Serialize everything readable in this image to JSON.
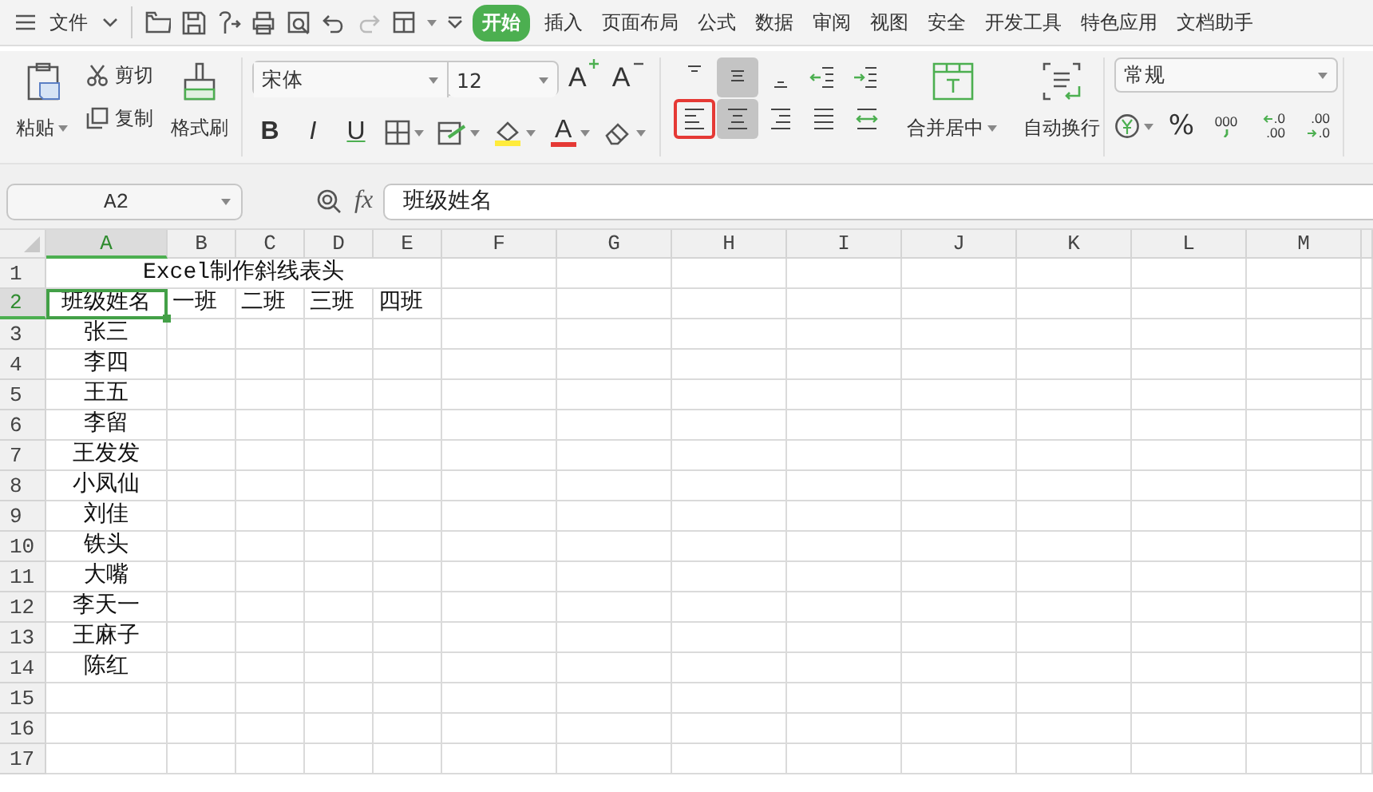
{
  "menu_bar": {
    "file_menu": "文件",
    "tabs": [
      {
        "label": "开始",
        "selected": true
      },
      {
        "label": "插入",
        "selected": false
      },
      {
        "label": "页面布局",
        "selected": false
      },
      {
        "label": "公式",
        "selected": false
      },
      {
        "label": "数据",
        "selected": false
      },
      {
        "label": "审阅",
        "selected": false
      },
      {
        "label": "视图",
        "selected": false
      },
      {
        "label": "安全",
        "selected": false
      },
      {
        "label": "开发工具",
        "selected": false
      },
      {
        "label": "特色应用",
        "selected": false
      },
      {
        "label": "文档助手",
        "selected": false
      }
    ]
  },
  "ribbon": {
    "clipboard": {
      "paste": "粘贴",
      "cut": "剪切",
      "copy": "复制",
      "format_painter": "格式刷"
    },
    "font": {
      "name": "宋体",
      "size": "12",
      "size_buttons": [
        {
          "kind": "grow",
          "label": "A"
        },
        {
          "kind": "shrink",
          "label": "A"
        }
      ],
      "style_buttons": [
        {
          "kind": "bold",
          "label": "B"
        },
        {
          "kind": "italic",
          "label": "I"
        },
        {
          "kind": "underline",
          "label": "U"
        },
        {
          "kind": "border"
        },
        {
          "kind": "cell-style"
        },
        {
          "kind": "fill-color"
        },
        {
          "kind": "font-color",
          "label": "A"
        },
        {
          "kind": "clear"
        }
      ]
    },
    "alignment": {
      "buttons": [
        {
          "kind": "top",
          "selected": false,
          "highlighted": false
        },
        {
          "kind": "middle",
          "selected": true,
          "highlighted": false
        },
        {
          "kind": "bottom",
          "selected": false,
          "highlighted": false
        },
        {
          "kind": "outdent",
          "selected": false,
          "highlighted": false
        },
        {
          "kind": "indent",
          "selected": false,
          "highlighted": false
        },
        {
          "kind": "left",
          "selected": false,
          "highlighted": true
        },
        {
          "kind": "center",
          "selected": true,
          "highlighted": false
        },
        {
          "kind": "right",
          "selected": false,
          "highlighted": false
        },
        {
          "kind": "justify",
          "selected": false,
          "highlighted": false
        },
        {
          "kind": "distribute",
          "selected": false,
          "highlighted": false
        }
      ],
      "merge": "合并居中",
      "wrap": "自动换行"
    },
    "number": {
      "format": "常规",
      "percent": "%",
      "thousands": "000",
      "increase_decimal": [
        ".0",
        ".00"
      ],
      "decrease_decimal": [
        ".00",
        ".0"
      ]
    }
  },
  "formula_bar": {
    "name_box": "A2",
    "fx": "fx",
    "value": "班级姓名"
  },
  "sheet": {
    "columns": [
      {
        "label": "A",
        "selected": true
      },
      {
        "label": "B",
        "selected": false
      },
      {
        "label": "C",
        "selected": false
      },
      {
        "label": "D",
        "selected": false
      },
      {
        "label": "E",
        "selected": false
      },
      {
        "label": "F",
        "selected": false
      },
      {
        "label": "G",
        "selected": false
      },
      {
        "label": "H",
        "selected": false
      },
      {
        "label": "I",
        "selected": false
      },
      {
        "label": "J",
        "selected": false
      },
      {
        "label": "K",
        "selected": false
      },
      {
        "label": "L",
        "selected": false
      },
      {
        "label": "M",
        "selected": false
      }
    ],
    "rows": [
      {
        "label": "1",
        "selected": false,
        "kind": "title",
        "merged_title": {
          "text": "Excel制作斜线表头",
          "active": false
        }
      },
      {
        "label": "2",
        "selected": true,
        "kind": "header",
        "cells": [
          {
            "text": "班级姓名",
            "active": true
          },
          {
            "text": "一班",
            "active": false
          },
          {
            "text": "二班",
            "active": false
          },
          {
            "text": "三班",
            "active": false
          },
          {
            "text": "四班",
            "active": false
          }
        ]
      },
      {
        "label": "3",
        "selected": false,
        "kind": "data",
        "cells": [
          {
            "text": "张三",
            "active": false
          }
        ]
      },
      {
        "label": "4",
        "selected": false,
        "kind": "data",
        "cells": [
          {
            "text": "李四",
            "active": false
          }
        ]
      },
      {
        "label": "5",
        "selected": false,
        "kind": "data",
        "cells": [
          {
            "text": "王五",
            "active": false
          }
        ]
      },
      {
        "label": "6",
        "selected": false,
        "kind": "data",
        "cells": [
          {
            "text": "李留",
            "active": false
          }
        ]
      },
      {
        "label": "7",
        "selected": false,
        "kind": "data",
        "cells": [
          {
            "text": "王发发",
            "active": false
          }
        ]
      },
      {
        "label": "8",
        "selected": false,
        "kind": "data",
        "cells": [
          {
            "text": "小凤仙",
            "active": false
          }
        ]
      },
      {
        "label": "9",
        "selected": false,
        "kind": "data",
        "cells": [
          {
            "text": "刘佳",
            "active": false
          }
        ]
      },
      {
        "label": "10",
        "selected": false,
        "kind": "data",
        "cells": [
          {
            "text": "铁头",
            "active": false
          }
        ]
      },
      {
        "label": "11",
        "selected": false,
        "kind": "data",
        "cells": [
          {
            "text": "大嘴",
            "active": false
          }
        ]
      },
      {
        "label": "12",
        "selected": false,
        "kind": "data",
        "cells": [
          {
            "text": "李天一",
            "active": false
          }
        ]
      },
      {
        "label": "13",
        "selected": false,
        "kind": "data",
        "cells": [
          {
            "text": "王麻子",
            "active": false
          }
        ]
      },
      {
        "label": "14",
        "selected": false,
        "kind": "data",
        "cells": [
          {
            "text": "陈红",
            "active": false
          }
        ]
      },
      {
        "label": "15",
        "selected": false,
        "kind": "data",
        "cells": []
      },
      {
        "label": "16",
        "selected": false,
        "kind": "data",
        "cells": []
      },
      {
        "label": "17",
        "selected": false,
        "kind": "data",
        "cells": []
      }
    ]
  }
}
